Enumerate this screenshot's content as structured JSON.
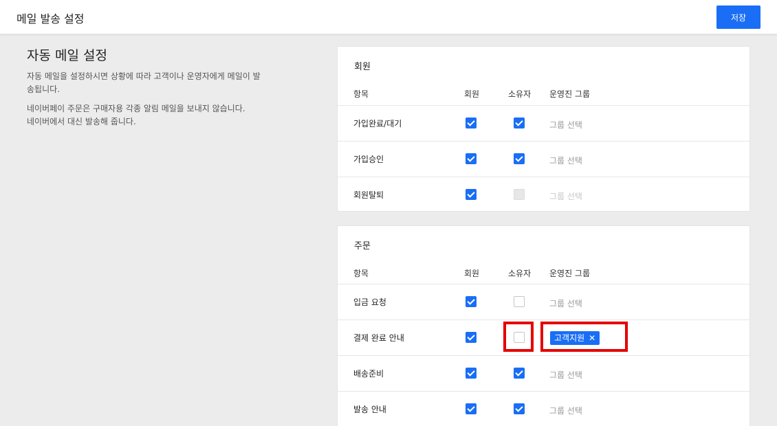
{
  "header": {
    "title": "메일 발송 설정",
    "save_label": "저장"
  },
  "intro": {
    "title": "자동 메일 설정",
    "desc1": "자동 메일을 설정하시면 상황에 따라 고객이나 운영자에게 메일이 발송됩니다.",
    "desc2_line1": "네이버페이 주문은 구매자용 각종 알림 메일을 보내지 않습니다.",
    "desc2_line2": "네이버에서 대신 발송해 줍니다."
  },
  "columns": {
    "item": "항목",
    "member": "회원",
    "owner": "소유자",
    "group": "운영진 그룹"
  },
  "member_section": {
    "title": "회원",
    "rows": [
      {
        "label": "가입완료/대기",
        "member": true,
        "owner": true,
        "owner_disabled": false,
        "group": "그룹 선택",
        "group_disabled": false
      },
      {
        "label": "가입승인",
        "member": true,
        "owner": true,
        "owner_disabled": false,
        "group": "그룹 선택",
        "group_disabled": false
      },
      {
        "label": "회원탈퇴",
        "member": true,
        "owner": false,
        "owner_disabled": true,
        "group": "그룹 선택",
        "group_disabled": true
      }
    ]
  },
  "order_section": {
    "title": "주문",
    "rows": [
      {
        "label": "입금 요청",
        "member": true,
        "owner": false,
        "group": "그룹 선택"
      },
      {
        "label": "결제 완료 안내",
        "member": true,
        "owner": false,
        "tag": "고객지원",
        "tag_remove_icon": "close-icon"
      },
      {
        "label": "배송준비",
        "member": true,
        "owner": true,
        "group": "그룹 선택"
      },
      {
        "label": "발송 안내",
        "member": true,
        "owner": true,
        "group": "그룹 선택"
      }
    ]
  },
  "colors": {
    "accent": "#1a6ef5",
    "highlight": "#e50000"
  }
}
